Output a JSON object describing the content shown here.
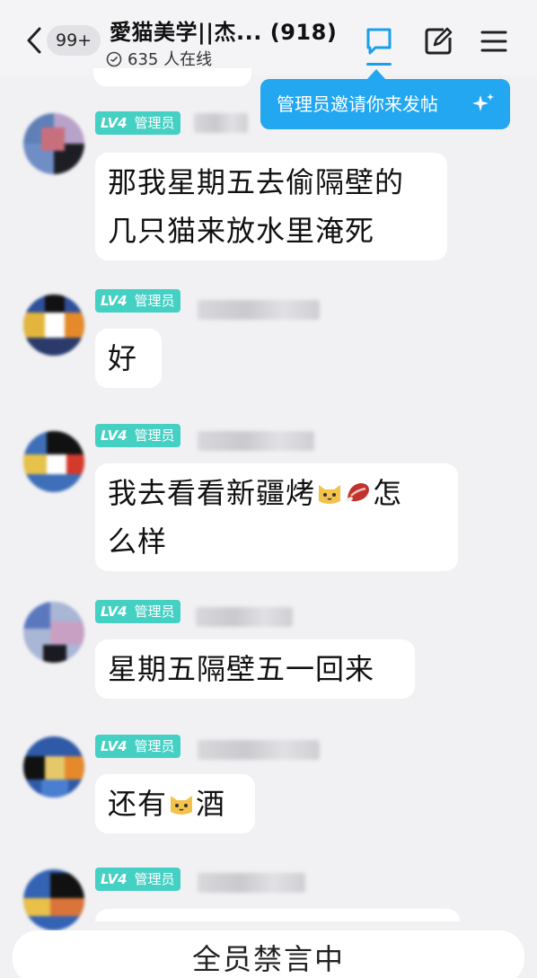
{
  "header": {
    "unread_count": "99+",
    "group_title": "愛猫美学||杰...",
    "member_count": "(918)",
    "online_text": "635 人在线"
  },
  "tooltip": {
    "text": "管理员邀请你来发帖"
  },
  "messages": [
    {
      "level": "LV4",
      "role": "管理员",
      "lines": [
        "那我星期五去偷隔壁的",
        "几只猫来放水里淹死"
      ]
    },
    {
      "level": "LV4",
      "role": "管理员",
      "lines": [
        "好"
      ]
    },
    {
      "level": "LV4",
      "role": "管理员",
      "line1_a": "我去看看新疆烤",
      "line1_b": "怎",
      "line2": "么样",
      "emojis": [
        "cat-face-emoji",
        "meat-emoji"
      ]
    },
    {
      "level": "LV4",
      "role": "管理员",
      "lines": [
        "星期五隔壁五一回来"
      ]
    },
    {
      "level": "LV4",
      "role": "管理员",
      "part_a": "还有",
      "part_b": "酒",
      "emojis": [
        "cat-face-emoji"
      ]
    },
    {
      "level": "LV4",
      "role": "管理员"
    }
  ],
  "footer": {
    "mute_status": "全员禁言中"
  },
  "colors": {
    "accent": "#22a7f0",
    "badge": "#45d0c4",
    "background": "#f1f1f3",
    "bubble": "#ffffff"
  }
}
